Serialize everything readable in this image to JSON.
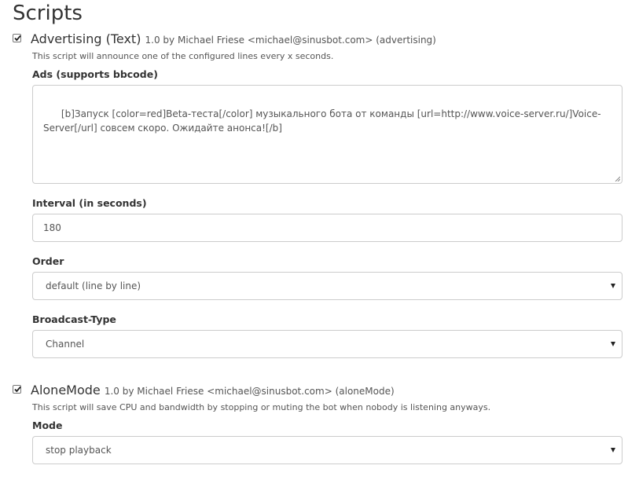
{
  "page": {
    "title": "Scripts"
  },
  "scripts": [
    {
      "name": "Advertising (Text)",
      "meta": "1.0 by Michael Friese <michael@sinusbot.com> (advertising)",
      "enabled": true,
      "description": "This script will announce one of the configured lines every x seconds.",
      "fields": {
        "ads": {
          "label": "Ads (supports bbcode)",
          "value": "[b]Запуск [color=red]Beta-теста[/color] музыкального бота от команды [url=http://www.voice-server.ru/]Voice-Server[/url] совсем скоро. Ожидайте анонса![/b]"
        },
        "interval": {
          "label": "Interval (in seconds)",
          "value": "180"
        },
        "order": {
          "label": "Order",
          "value": "default (line by line)"
        },
        "broadcast": {
          "label": "Broadcast-Type",
          "value": "Channel"
        }
      }
    },
    {
      "name": "AloneMode",
      "meta": "1.0 by Michael Friese <michael@sinusbot.com> (aloneMode)",
      "enabled": true,
      "description": "This script will save CPU and bandwidth by stopping or muting the bot when nobody is listening anyways.",
      "fields": {
        "mode": {
          "label": "Mode",
          "value": "stop playback"
        }
      }
    }
  ]
}
